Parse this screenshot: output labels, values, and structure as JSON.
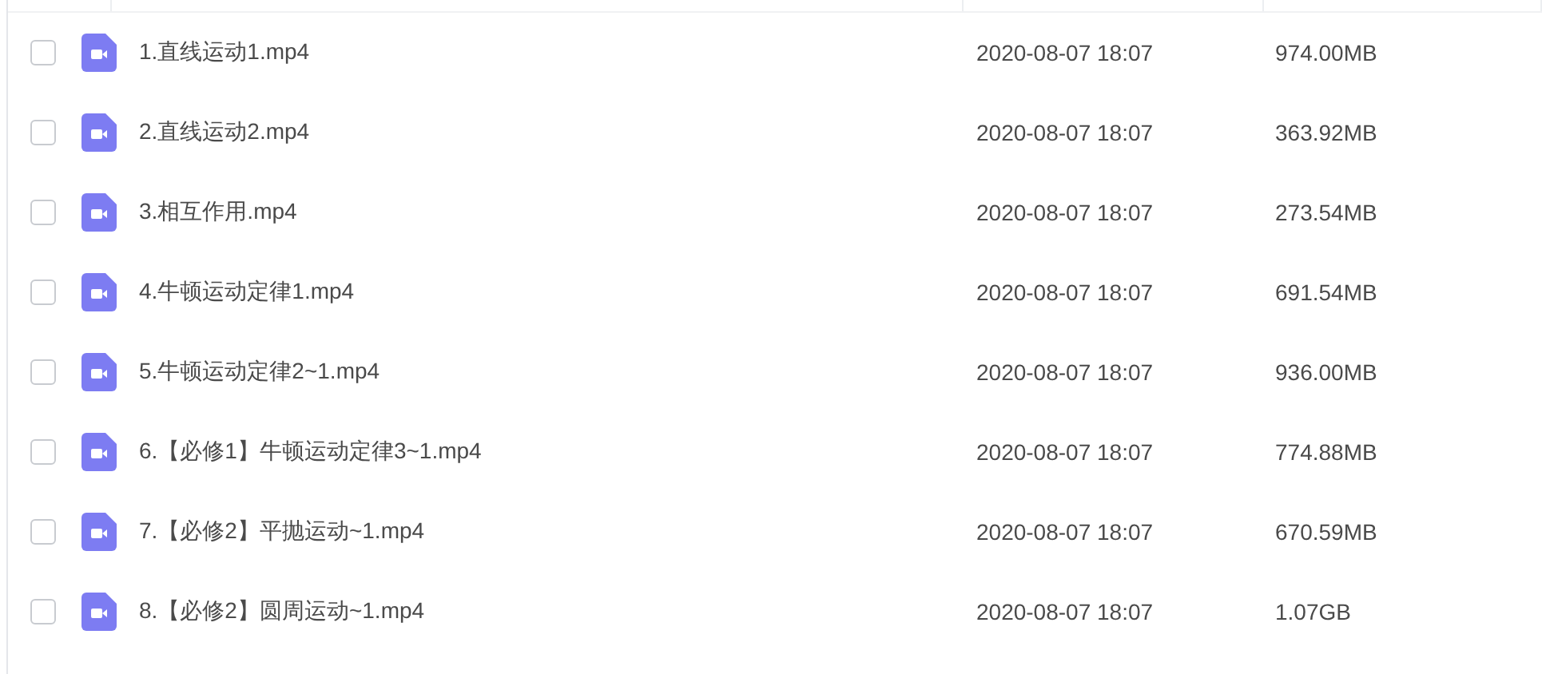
{
  "files": [
    {
      "name": "1.直线运动1.mp4",
      "modified": "2020-08-07 18:07",
      "size": "974.00MB",
      "checked": false
    },
    {
      "name": "2.直线运动2.mp4",
      "modified": "2020-08-07 18:07",
      "size": "363.92MB",
      "checked": false
    },
    {
      "name": "3.相互作用.mp4",
      "modified": "2020-08-07 18:07",
      "size": "273.54MB",
      "checked": false
    },
    {
      "name": "4.牛顿运动定律1.mp4",
      "modified": "2020-08-07 18:07",
      "size": "691.54MB",
      "checked": false
    },
    {
      "name": "5.牛顿运动定律2~1.mp4",
      "modified": "2020-08-07 18:07",
      "size": "936.00MB",
      "checked": false
    },
    {
      "name": "6.【必修1】牛顿运动定律3~1.mp4",
      "modified": "2020-08-07 18:07",
      "size": "774.88MB",
      "checked": false
    },
    {
      "name": "7.【必修2】平抛运动~1.mp4",
      "modified": "2020-08-07 18:07",
      "size": "670.59MB",
      "checked": false
    },
    {
      "name": "8.【必修2】圆周运动~1.mp4",
      "modified": "2020-08-07 18:07",
      "size": "1.07GB",
      "checked": false
    }
  ]
}
